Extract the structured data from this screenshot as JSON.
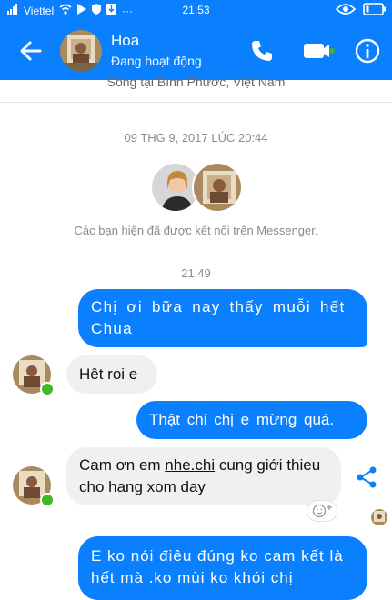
{
  "status_bar": {
    "carrier": "Viettel",
    "time": "21:53",
    "more": "···"
  },
  "header": {
    "name": "Hoa",
    "status": "Đang hoạt động"
  },
  "peek_text": "Sống tại Bình Phước, Việt Nam",
  "thread": {
    "date_separator": "09 THG 9, 2017 LÚC 20:44",
    "connected_text": "Các bạn hiện đã được kết nối trên Messenger.",
    "time_separator": "21:49"
  },
  "messages": [
    {
      "direction": "outgoing",
      "text": "Chị ơi bữa nay thấy muỗi hết Chua"
    },
    {
      "direction": "incoming",
      "text": "Hêt roi e"
    },
    {
      "direction": "outgoing",
      "text": "Thật chi chị e mừng quá."
    },
    {
      "direction": "incoming",
      "text_before": "Cam ơn em ",
      "link": "nhe.chi",
      "text_after": " cung giới thieu cho hang xom day"
    },
    {
      "direction": "outgoing",
      "text": "E ko nói điêu đúng ko cam kết là hết mà .ko mùi ko khói chị"
    }
  ],
  "colors": {
    "brand": "#0a80ff",
    "incoming_bubble": "#f1f0f0",
    "online": "#42b72a"
  }
}
